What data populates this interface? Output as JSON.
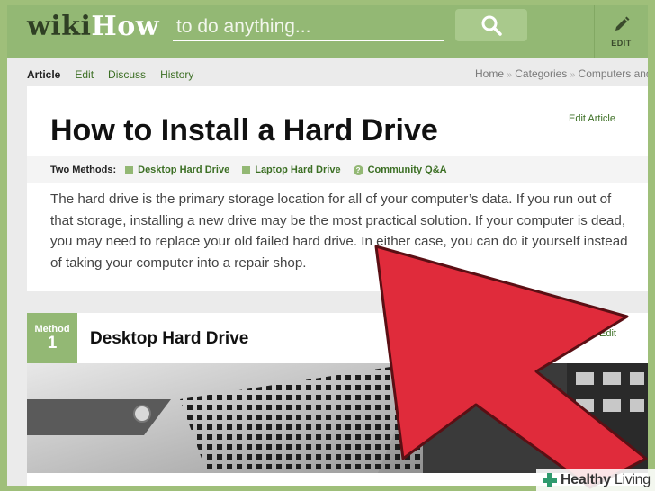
{
  "header": {
    "logo_wiki": "wiki",
    "logo_how": "How",
    "search_placeholder": "to do anything...",
    "edit_label": "EDIT",
    "accent_color": "#93b874"
  },
  "nav": {
    "tabs": [
      "Article",
      "Edit",
      "Discuss",
      "History"
    ],
    "breadcrumb": [
      "Home",
      "Categories",
      "Computers and E"
    ]
  },
  "article": {
    "title": "How to Install a Hard Drive",
    "edit_link": "Edit Article",
    "methods_label": "Two Methods:",
    "methods": [
      "Desktop Hard Drive",
      "Laptop Hard Drive"
    ],
    "community_link": "Community Q&A",
    "intro": "The hard drive is the primary storage location for all of your computer’s data. If you run out of that storage, installing a new drive may be the most practical solution. If your computer is dead, you may need to replace your old failed hard drive. In either case, you can do it yourself instead of taking your computer into a repair shop."
  },
  "method": {
    "badge_word": "Method",
    "badge_number": "1",
    "title": "Desktop Hard Drive",
    "edit_link": "Edit"
  },
  "icons": {
    "search": "search-icon",
    "edit": "pencil-icon",
    "arrow": "red-pointer-arrow",
    "watermark": "healthy-living-cross-icon"
  },
  "watermark": {
    "brand": "Healthy",
    "brand2": "Living"
  }
}
